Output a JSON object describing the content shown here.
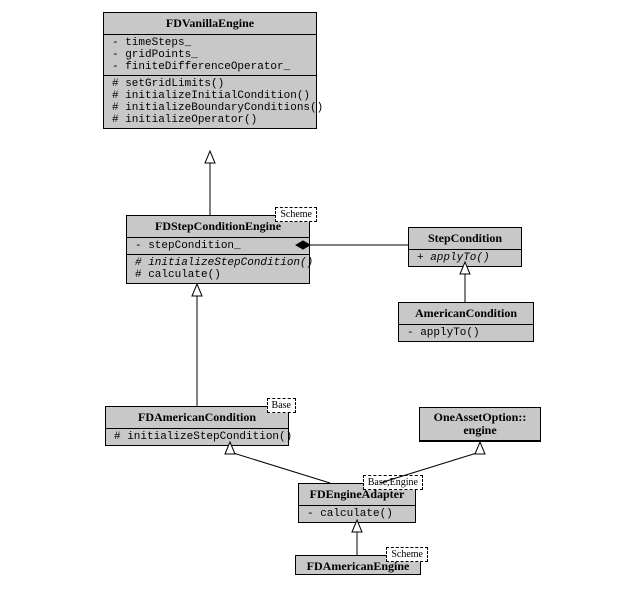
{
  "diagram_type": "UML class diagram",
  "classes": {
    "fdvanilla": {
      "name": "FDVanillaEngine",
      "attrs": [
        "- timeSteps_",
        "- gridPoints_",
        "- finiteDifferenceOperator_"
      ],
      "ops": [
        "# setGridLimits()",
        "# initializeInitialCondition()",
        "# initializeBoundaryConditions()",
        "# initializeOperator()"
      ]
    },
    "fdstep": {
      "name": "FDStepConditionEngine",
      "template": "Scheme",
      "attrs": [
        "- stepCondition_"
      ],
      "ops_italic": [
        "# initializeStepCondition()"
      ],
      "ops": [
        "# calculate()"
      ]
    },
    "stepcond": {
      "name": "StepCondition",
      "ops_italic": [
        "+ applyTo()"
      ]
    },
    "americancond": {
      "name": "AmericanCondition",
      "ops": [
        "- applyTo()"
      ]
    },
    "fdamericancond": {
      "name": "FDAmericanCondition",
      "template": "Base",
      "ops": [
        "# initializeStepCondition()"
      ]
    },
    "oneasset": {
      "name_l1": "OneAssetOption::",
      "name_l2": "engine"
    },
    "fdengineadapter": {
      "name": "FDEngineAdapter",
      "template": "Base,Engine",
      "ops": [
        "- calculate()"
      ]
    },
    "fdamericaneng": {
      "name": "FDAmericanEngine",
      "template": "Scheme"
    }
  },
  "relations": [
    {
      "from": "FDStepConditionEngine",
      "to": "FDVanillaEngine",
      "type": "generalization"
    },
    {
      "from": "FDStepConditionEngine",
      "to": "StepCondition",
      "type": "composition"
    },
    {
      "from": "AmericanCondition",
      "to": "StepCondition",
      "type": "generalization"
    },
    {
      "from": "FDAmericanCondition",
      "to": "FDStepConditionEngine",
      "type": "generalization"
    },
    {
      "from": "FDEngineAdapter",
      "to": "FDAmericanCondition",
      "type": "generalization"
    },
    {
      "from": "FDEngineAdapter",
      "to": "OneAssetOption::engine",
      "type": "generalization"
    },
    {
      "from": "FDAmericanEngine",
      "to": "FDEngineAdapter",
      "type": "generalization"
    }
  ]
}
